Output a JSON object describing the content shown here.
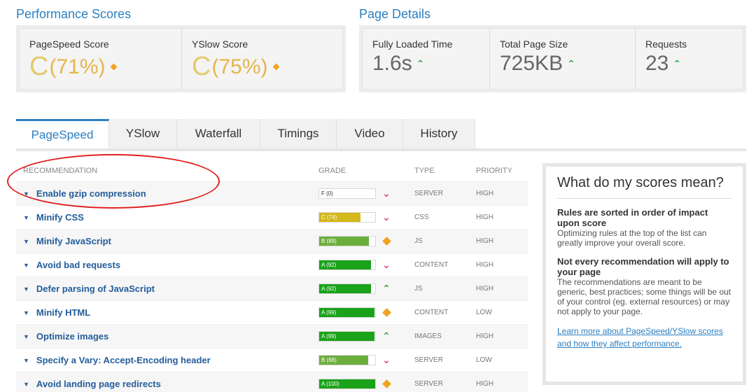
{
  "performance": {
    "title": "Performance Scores",
    "pagespeed": {
      "label": "PageSpeed Score",
      "grade": "C",
      "percent": "(71%)"
    },
    "yslow": {
      "label": "YSlow Score",
      "grade": "C",
      "percent": "(75%)"
    }
  },
  "details": {
    "title": "Page Details",
    "loaded": {
      "label": "Fully Loaded Time",
      "value": "1.6s"
    },
    "size": {
      "label": "Total Page Size",
      "value": "725KB"
    },
    "requests": {
      "label": "Requests",
      "value": "23"
    }
  },
  "tabs": [
    "PageSpeed",
    "YSlow",
    "Waterfall",
    "Timings",
    "Video",
    "History"
  ],
  "table": {
    "headers": {
      "recommendation": "RECOMMENDATION",
      "grade": "GRADE",
      "type": "TYPE",
      "priority": "PRIORITY"
    },
    "rows": [
      {
        "label": "Enable gzip compression",
        "grade": "F (0)",
        "score": 0,
        "color": "#ffffff",
        "trend": "down",
        "type": "SERVER",
        "priority": "HIGH"
      },
      {
        "label": "Minify CSS",
        "grade": "C (74)",
        "score": 74,
        "color": "#d4b81c",
        "trend": "down",
        "type": "CSS",
        "priority": "HIGH"
      },
      {
        "label": "Minify JavaScript",
        "grade": "B (89)",
        "score": 89,
        "color": "#6cae3c",
        "trend": "flat",
        "type": "JS",
        "priority": "HIGH"
      },
      {
        "label": "Avoid bad requests",
        "grade": "A (92)",
        "score": 92,
        "color": "#1aa21a",
        "trend": "down",
        "type": "CONTENT",
        "priority": "HIGH"
      },
      {
        "label": "Defer parsing of JavaScript",
        "grade": "A (92)",
        "score": 92,
        "color": "#1aa21a",
        "trend": "up",
        "type": "JS",
        "priority": "HIGH"
      },
      {
        "label": "Minify HTML",
        "grade": "A (99)",
        "score": 99,
        "color": "#1aa21a",
        "trend": "flat",
        "type": "CONTENT",
        "priority": "LOW"
      },
      {
        "label": "Optimize images",
        "grade": "A (99)",
        "score": 99,
        "color": "#1aa21a",
        "trend": "up",
        "type": "IMAGES",
        "priority": "HIGH"
      },
      {
        "label": "Specify a Vary: Accept-Encoding header",
        "grade": "B (88)",
        "score": 88,
        "color": "#6cae3c",
        "trend": "down",
        "type": "SERVER",
        "priority": "LOW"
      },
      {
        "label": "Avoid landing page redirects",
        "grade": "A (100)",
        "score": 100,
        "color": "#1aa21a",
        "trend": "flat",
        "type": "SERVER",
        "priority": "HIGH"
      }
    ]
  },
  "sidebar": {
    "title": "What do my scores mean?",
    "s1_bold": "Rules are sorted in order of impact upon score",
    "s1_text": "Optimizing rules at the top of the list can greatly improve your overall score.",
    "s2_bold": "Not every recommendation will apply to your page",
    "s2_text": "The recommendations are meant to be generic, best practices; some things will be out of your control (eg. external resources) or may not apply to your page.",
    "link": "Learn more about PageSpeed/YSlow scores and how they affect performance."
  }
}
